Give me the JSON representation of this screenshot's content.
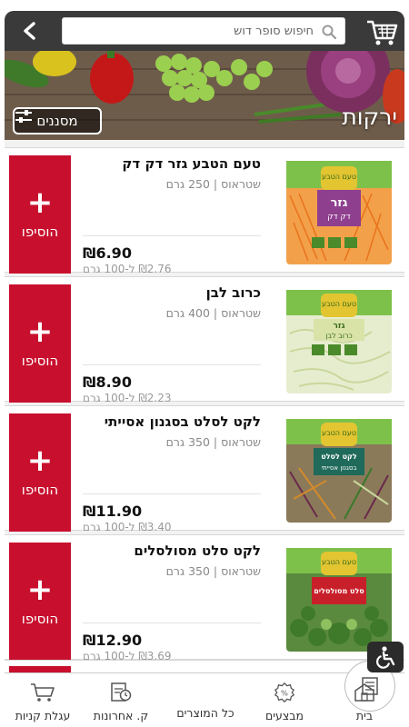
{
  "header": {
    "search_placeholder": "חיפוש סופר דוש",
    "back_icon": "chevron-left-icon",
    "logo_icon": "shopping-cart-icon"
  },
  "banner": {
    "title": "ירקות",
    "filters_label": "מסננים"
  },
  "products": [
    {
      "name": "טעם הטבע גזר דק דק",
      "brand": "שטראוס",
      "weight": "250 גרם",
      "price": "₪6.90",
      "unit_price": "₪2.76 ל-100 גרם",
      "add_label": "הוסיפו"
    },
    {
      "name": "כרוב לבן",
      "brand": "שטראוס",
      "weight": "400 גרם",
      "price": "₪8.90",
      "unit_price": "₪2.23 ל-100 גרם",
      "add_label": "הוסיפו"
    },
    {
      "name": "לקט לסלט בסגנון אסייתי",
      "brand": "שטראוס",
      "weight": "350 גרם",
      "price": "₪11.90",
      "unit_price": "₪3.40 ל-100 גרם",
      "add_label": "הוסיפו"
    },
    {
      "name": "לקט סלט מסולסלים",
      "brand": "שטראוס",
      "weight": "350 גרם",
      "price": "₪12.90",
      "unit_price": "₪3.69 ל-100 גרם",
      "add_label": "הוסיפו"
    }
  ],
  "package_labels": [
    {
      "brand": "טעם הטבע",
      "title": "גזר",
      "subtitle": "דק דק",
      "color": "#f07a1a"
    },
    {
      "brand": "טעם הטבע",
      "title": "גזר",
      "subtitle": "כרוב לבן",
      "color": "#dfe9c2"
    },
    {
      "brand": "טעם הטבע",
      "title": "לקט לסלט",
      "subtitle": "בסגנון אסייתי",
      "color": "#5a2e3a"
    },
    {
      "brand": "טעם הטבע",
      "title": "סלט מסולסלים",
      "subtitle": "",
      "color": "#4f8a3a"
    }
  ],
  "bottom_nav": {
    "home": "בית",
    "deals": "מבצעים",
    "all_products": "כל המוצרים",
    "recent": "ק. אחרונות",
    "cart": "עגלת קניות"
  },
  "colors": {
    "accent_red": "#c8102e",
    "header_dark": "#3a3a3a"
  }
}
